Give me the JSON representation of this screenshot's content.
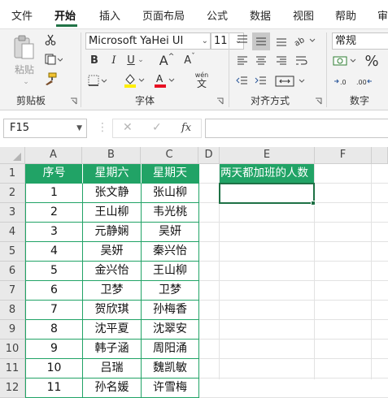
{
  "ribbon_tabs": [
    "文件",
    "开始",
    "插入",
    "页面布局",
    "公式",
    "数据",
    "视图",
    "帮助",
    "审"
  ],
  "active_tab": "开始",
  "clipboard": {
    "paste_label": "粘贴",
    "group_label": "剪贴板"
  },
  "font": {
    "font_name": "Microsoft YaHei UI",
    "font_size": "11",
    "bold_label": "B",
    "italic_label": "I",
    "underline_label": "U",
    "grow_label": "A",
    "shrink_label": "A",
    "phonetic_label": "wén",
    "group_label": "字体"
  },
  "alignment": {
    "group_label": "对齐方式"
  },
  "number": {
    "format_value": "常规",
    "percent_label": "%",
    "group_label": "数字"
  },
  "formula_bar": {
    "name_box": "F15",
    "cancel_symbol": "✕",
    "enter_symbol": "✓",
    "fx_label": "fx",
    "formula_value": ""
  },
  "sheet": {
    "column_headers": [
      "A",
      "B",
      "C",
      "D",
      "E",
      "F"
    ],
    "row_headers": [
      "1",
      "2",
      "3",
      "4",
      "5",
      "6",
      "7",
      "8",
      "9",
      "10",
      "11",
      "12"
    ],
    "table_header": [
      "序号",
      "星期六",
      "星期天"
    ],
    "rows": [
      [
        "1",
        "张文静",
        "张山柳"
      ],
      [
        "2",
        "王山柳",
        "韦光桃"
      ],
      [
        "3",
        "元静娴",
        "吴妍"
      ],
      [
        "4",
        "吴妍",
        "秦兴怡"
      ],
      [
        "5",
        "金兴怡",
        "王山柳"
      ],
      [
        "6",
        "卫梦",
        "卫梦"
      ],
      [
        "7",
        "贺欣琪",
        "孙梅香"
      ],
      [
        "8",
        "沈平夏",
        "沈翠安"
      ],
      [
        "9",
        "韩子涵",
        "周阳涌"
      ],
      [
        "10",
        "吕瑞",
        "魏凯敏"
      ],
      [
        "11",
        "孙名媛",
        "许雪梅"
      ]
    ],
    "e1_text": "两天都加班的人数"
  },
  "colors": {
    "accent": "#217346",
    "table_green": "#21a366",
    "font_color": "#e81123",
    "highlight": "#ffee00"
  }
}
